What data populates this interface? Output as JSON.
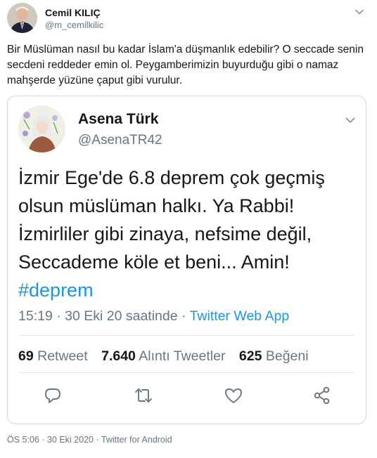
{
  "author": {
    "name": "Cemil KILIÇ",
    "handle": "@m_cemilkilic"
  },
  "tweet_text": "Bir Müslüman nasıl bu kadar İslam'a düşmanlık edebilir? O seccade senin secdeni reddeder emin ol. Peygamberimizin buyurduğu gibi o namaz mahşerde yüzüne çaput gibi vurulur.",
  "quoted": {
    "name": "Asena Türk",
    "handle": "@AsenaTR42",
    "text": "İzmir Ege'de 6.8  deprem çok geçmiş olsun müslüman halkı. Ya Rabbi! İzmirliler gibi zinaya, nefsime değil, Seccademe köle et beni... Amin! ",
    "hashtag": "#deprem",
    "time": "15:19 · 30 Eki 20 saatinde · ",
    "app": "Twitter Web App",
    "retweet_count": "69",
    "retweet_label": "Retweet",
    "quote_count": "7.640",
    "quote_label": "Alıntı Tweetler",
    "like_count": "625",
    "like_label": "Beğeni"
  },
  "footer": {
    "time": "ÖS 5:06 · 30 Eki 2020 · ",
    "app": "Twitter for Android"
  },
  "colors": {
    "link": "#1b95e0",
    "secondary": "#657786",
    "border": "#cfd9de"
  },
  "icons": {
    "caret": "chevron-down-icon",
    "reply": "reply-icon",
    "retweet": "retweet-icon",
    "like": "heart-icon",
    "share": "share-icon"
  }
}
